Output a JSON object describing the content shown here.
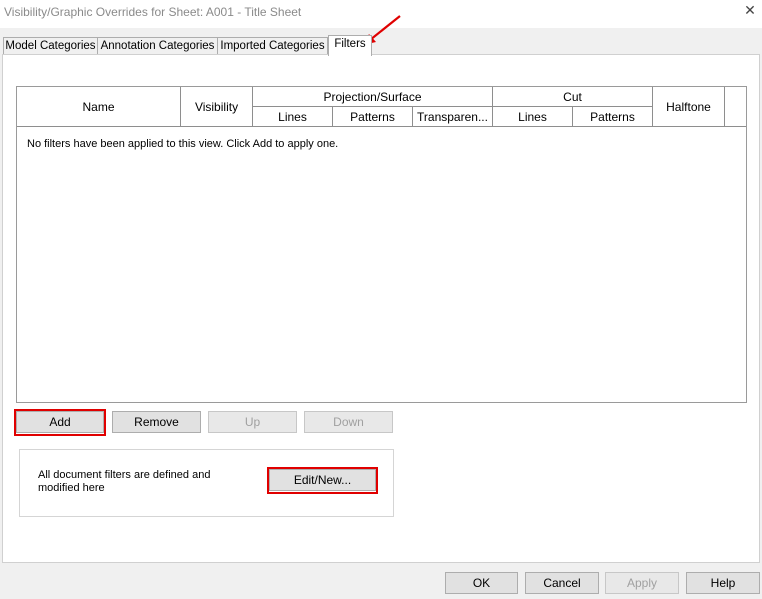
{
  "window": {
    "title": "Visibility/Graphic Overrides for Sheet: A001 - Title Sheet",
    "close_glyph": "✕"
  },
  "tabs": [
    {
      "label": "Model Categories"
    },
    {
      "label": "Annotation Categories"
    },
    {
      "label": "Imported Categories"
    },
    {
      "label": "Filters"
    }
  ],
  "grid": {
    "name": "Name",
    "visibility": "Visibility",
    "projection_surface": "Projection/Surface",
    "cut": "Cut",
    "halftone": "Halftone",
    "proj_lines": "Lines",
    "proj_patterns": "Patterns",
    "proj_transparency": "Transparen...",
    "cut_lines": "Lines",
    "cut_patterns": "Patterns",
    "empty_message": "No filters have been applied to this view. Click Add to apply one."
  },
  "actions": {
    "add": "Add",
    "remove": "Remove",
    "up": "Up",
    "down": "Down"
  },
  "filters_box": {
    "text": "All document filters are defined and modified here",
    "edit_new": "Edit/New..."
  },
  "footer": {
    "ok": "OK",
    "cancel": "Cancel",
    "apply": "Apply",
    "help": "Help"
  },
  "colors": {
    "highlight": "#e00000",
    "arrow": "#e00000"
  }
}
